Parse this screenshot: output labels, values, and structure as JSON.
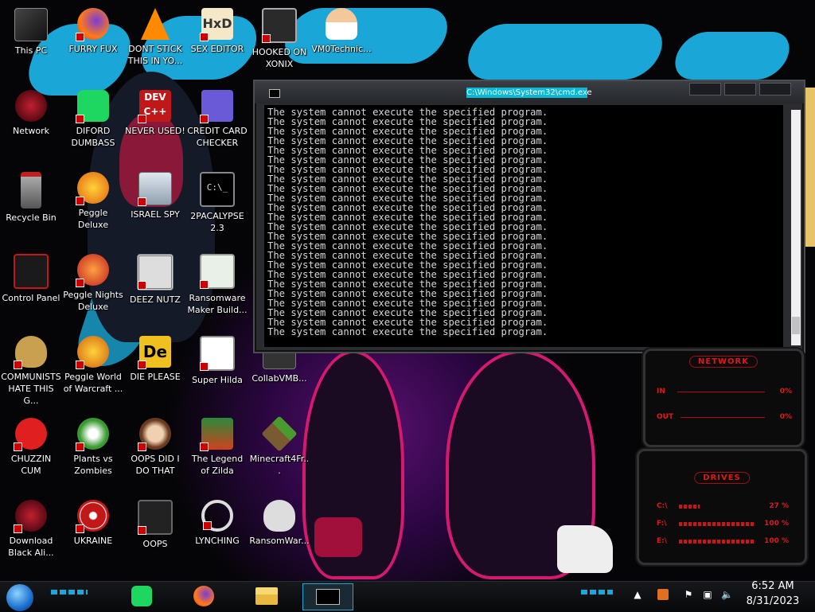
{
  "desktop": {
    "icons": [
      {
        "label": "This PC"
      },
      {
        "label": "FURRY FUX"
      },
      {
        "label": "DONT STICK THIS IN YO..."
      },
      {
        "label": "SEX EDITOR"
      },
      {
        "label": "HOOKED ON XONIX"
      },
      {
        "label": "VM0Technic..."
      },
      {
        "label": "Network"
      },
      {
        "label": "DIFORD DUMBASS"
      },
      {
        "label": "NEVER USED!"
      },
      {
        "label": "CREDIT CARD CHECKER"
      },
      {
        "label": "Recycle Bin"
      },
      {
        "label": "Peggle Deluxe"
      },
      {
        "label": "ISRAEL SPY"
      },
      {
        "label": "2PACALYPSE 2.3"
      },
      {
        "label": "Control Panel"
      },
      {
        "label": "Peggle Nights Deluxe"
      },
      {
        "label": "DEEZ NUTZ"
      },
      {
        "label": "Ransomware Maker Build..."
      },
      {
        "label": "COMMUNISTS HATE THIS G..."
      },
      {
        "label": "Peggle World of Warcraft ..."
      },
      {
        "label": "DIE PLEASE"
      },
      {
        "label": "Super Hilda"
      },
      {
        "label": "CollabVMB..."
      },
      {
        "label": "CHUZZIN CUM"
      },
      {
        "label": "Plants vs Zombies"
      },
      {
        "label": "OOPS DID I DO THAT"
      },
      {
        "label": "The Legend of Zilda"
      },
      {
        "label": "Minecraft4Fr..."
      },
      {
        "label": "Download Black Ali..."
      },
      {
        "label": "UKRAINE"
      },
      {
        "label": "OOPS"
      },
      {
        "label": "LYNCHING"
      },
      {
        "label": "RansomWar..."
      }
    ]
  },
  "cmd": {
    "title": "C:\\Windows\\System32\\cmd.exe",
    "message": "The system cannot execute the specified program.",
    "line_count": 24
  },
  "network_gadget": {
    "title": "NETWORK",
    "in_label": "IN",
    "in_value": "0%",
    "out_label": "OUT",
    "out_value": "0%"
  },
  "drives_gadget": {
    "title": "DRIVES",
    "drives": [
      {
        "label": "C:\\",
        "value": "27 %",
        "fill": 0.27
      },
      {
        "label": "F:\\",
        "value": "100 %",
        "fill": 1.0
      },
      {
        "label": "E:\\",
        "value": "100 %",
        "fill": 1.0
      }
    ]
  },
  "taskbar": {
    "pinned": [
      "spotify-icon",
      "firefox-icon",
      "file-explorer-icon",
      "cmd-icon"
    ],
    "time": "6:52 AM",
    "date": "8/31/2023"
  },
  "colors": {
    "accent_red": "#e01818",
    "cmd_title_bg": "#0ab8d8",
    "wallpaper_blue": "#1aa6d6"
  }
}
